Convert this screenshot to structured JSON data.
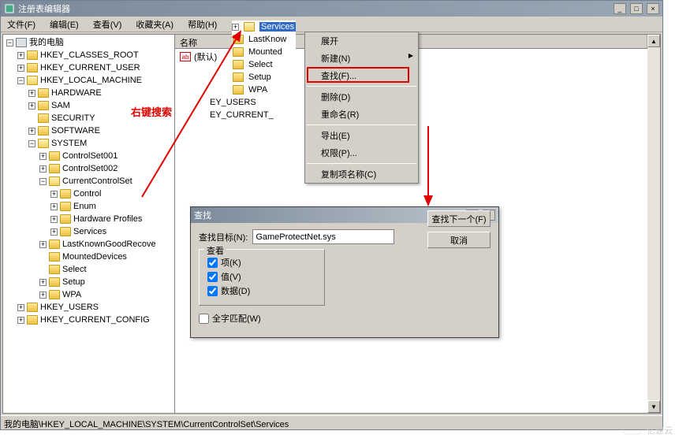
{
  "window": {
    "title": "注册表编辑器",
    "btn_min": "_",
    "btn_max": "□",
    "btn_close": "×"
  },
  "menubar": {
    "file": "文件(F)",
    "edit": "编辑(E)",
    "view": "查看(V)",
    "favorites": "收藏夹(A)",
    "help": "帮助(H)"
  },
  "tree": {
    "root": "我的电脑",
    "hkcr": "HKEY_CLASSES_ROOT",
    "hkcu": "HKEY_CURRENT_USER",
    "hklm": "HKEY_LOCAL_MACHINE",
    "hardware": "HARDWARE",
    "sam": "SAM",
    "security": "SECURITY",
    "software": "SOFTWARE",
    "system": "SYSTEM",
    "cs001": "ControlSet001",
    "cs002": "ControlSet002",
    "ccs": "CurrentControlSet",
    "control": "Control",
    "enum": "Enum",
    "hwprofiles": "Hardware Profiles",
    "services": "Services",
    "lkgr": "LastKnownGoodRecove",
    "mounted": "MountedDevices",
    "select": "Select",
    "setup": "Setup",
    "wpa": "WPA",
    "hku": "HKEY_USERS",
    "hkcc": "HKEY_CURRENT_CONFIG"
  },
  "listheader": {
    "name": "名称"
  },
  "listrow": {
    "default": "(默认)"
  },
  "subtree": {
    "services": "Services",
    "lastknow": "LastKnow",
    "mounted": "Mounted",
    "select": "Select",
    "setup": "Setup",
    "wpa": "WPA",
    "ey_users": "EY_USERS",
    "ey_current": "EY_CURRENT_"
  },
  "context": {
    "expand": "展开",
    "new": "新建(N)",
    "find": "查找(F)...",
    "delete": "删除(D)",
    "rename": "重命名(R)",
    "export": "导出(E)",
    "permissions": "权限(P)...",
    "copykeyname": "复制项名称(C)"
  },
  "annotation": "右键搜索",
  "dialog": {
    "title": "查找",
    "label_target": "查找目标(N):",
    "input_value": "GameProtectNet.sys",
    "btn_findnext": "查找下一个(F)",
    "btn_cancel": "取消",
    "group_title": "查看",
    "chk_key": "项(K)",
    "chk_value": "值(V)",
    "chk_data": "数据(D)",
    "chk_wholeword": "全字匹配(W)",
    "help": "?",
    "close": "×"
  },
  "statusbar": "我的电脑\\HKEY_LOCAL_MACHINE\\SYSTEM\\CurrentControlSet\\Services",
  "watermark": "亿速云"
}
